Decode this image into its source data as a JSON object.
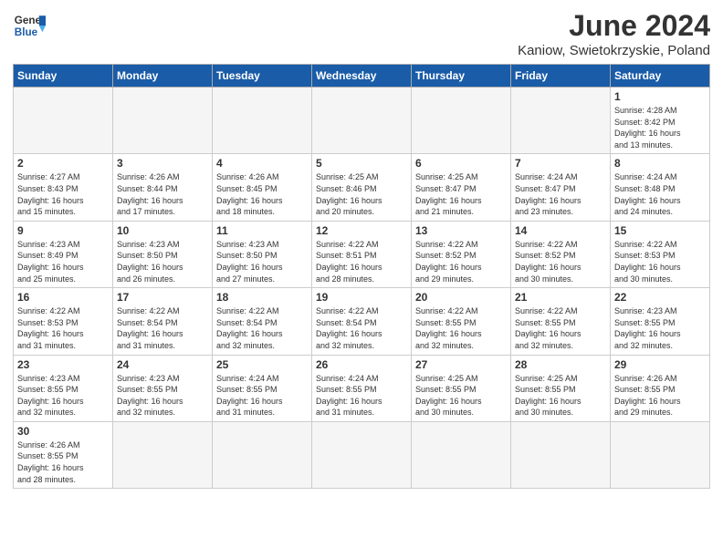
{
  "header": {
    "logo_general": "General",
    "logo_blue": "Blue",
    "title": "June 2024",
    "location": "Kaniow, Swietokrzyskie, Poland"
  },
  "days_of_week": [
    "Sunday",
    "Monday",
    "Tuesday",
    "Wednesday",
    "Thursday",
    "Friday",
    "Saturday"
  ],
  "weeks": [
    [
      {
        "day": "",
        "info": ""
      },
      {
        "day": "",
        "info": ""
      },
      {
        "day": "",
        "info": ""
      },
      {
        "day": "",
        "info": ""
      },
      {
        "day": "",
        "info": ""
      },
      {
        "day": "",
        "info": ""
      },
      {
        "day": "1",
        "info": "Sunrise: 4:28 AM\nSunset: 8:42 PM\nDaylight: 16 hours\nand 13 minutes."
      }
    ],
    [
      {
        "day": "2",
        "info": "Sunrise: 4:27 AM\nSunset: 8:43 PM\nDaylight: 16 hours\nand 15 minutes."
      },
      {
        "day": "3",
        "info": "Sunrise: 4:26 AM\nSunset: 8:44 PM\nDaylight: 16 hours\nand 17 minutes."
      },
      {
        "day": "4",
        "info": "Sunrise: 4:26 AM\nSunset: 8:45 PM\nDaylight: 16 hours\nand 18 minutes."
      },
      {
        "day": "5",
        "info": "Sunrise: 4:25 AM\nSunset: 8:46 PM\nDaylight: 16 hours\nand 20 minutes."
      },
      {
        "day": "6",
        "info": "Sunrise: 4:25 AM\nSunset: 8:47 PM\nDaylight: 16 hours\nand 21 minutes."
      },
      {
        "day": "7",
        "info": "Sunrise: 4:24 AM\nSunset: 8:47 PM\nDaylight: 16 hours\nand 23 minutes."
      },
      {
        "day": "8",
        "info": "Sunrise: 4:24 AM\nSunset: 8:48 PM\nDaylight: 16 hours\nand 24 minutes."
      }
    ],
    [
      {
        "day": "9",
        "info": "Sunrise: 4:23 AM\nSunset: 8:49 PM\nDaylight: 16 hours\nand 25 minutes."
      },
      {
        "day": "10",
        "info": "Sunrise: 4:23 AM\nSunset: 8:50 PM\nDaylight: 16 hours\nand 26 minutes."
      },
      {
        "day": "11",
        "info": "Sunrise: 4:23 AM\nSunset: 8:50 PM\nDaylight: 16 hours\nand 27 minutes."
      },
      {
        "day": "12",
        "info": "Sunrise: 4:22 AM\nSunset: 8:51 PM\nDaylight: 16 hours\nand 28 minutes."
      },
      {
        "day": "13",
        "info": "Sunrise: 4:22 AM\nSunset: 8:52 PM\nDaylight: 16 hours\nand 29 minutes."
      },
      {
        "day": "14",
        "info": "Sunrise: 4:22 AM\nSunset: 8:52 PM\nDaylight: 16 hours\nand 30 minutes."
      },
      {
        "day": "15",
        "info": "Sunrise: 4:22 AM\nSunset: 8:53 PM\nDaylight: 16 hours\nand 30 minutes."
      }
    ],
    [
      {
        "day": "16",
        "info": "Sunrise: 4:22 AM\nSunset: 8:53 PM\nDaylight: 16 hours\nand 31 minutes."
      },
      {
        "day": "17",
        "info": "Sunrise: 4:22 AM\nSunset: 8:54 PM\nDaylight: 16 hours\nand 31 minutes."
      },
      {
        "day": "18",
        "info": "Sunrise: 4:22 AM\nSunset: 8:54 PM\nDaylight: 16 hours\nand 32 minutes."
      },
      {
        "day": "19",
        "info": "Sunrise: 4:22 AM\nSunset: 8:54 PM\nDaylight: 16 hours\nand 32 minutes."
      },
      {
        "day": "20",
        "info": "Sunrise: 4:22 AM\nSunset: 8:55 PM\nDaylight: 16 hours\nand 32 minutes."
      },
      {
        "day": "21",
        "info": "Sunrise: 4:22 AM\nSunset: 8:55 PM\nDaylight: 16 hours\nand 32 minutes."
      },
      {
        "day": "22",
        "info": "Sunrise: 4:23 AM\nSunset: 8:55 PM\nDaylight: 16 hours\nand 32 minutes."
      }
    ],
    [
      {
        "day": "23",
        "info": "Sunrise: 4:23 AM\nSunset: 8:55 PM\nDaylight: 16 hours\nand 32 minutes."
      },
      {
        "day": "24",
        "info": "Sunrise: 4:23 AM\nSunset: 8:55 PM\nDaylight: 16 hours\nand 32 minutes."
      },
      {
        "day": "25",
        "info": "Sunrise: 4:24 AM\nSunset: 8:55 PM\nDaylight: 16 hours\nand 31 minutes."
      },
      {
        "day": "26",
        "info": "Sunrise: 4:24 AM\nSunset: 8:55 PM\nDaylight: 16 hours\nand 31 minutes."
      },
      {
        "day": "27",
        "info": "Sunrise: 4:25 AM\nSunset: 8:55 PM\nDaylight: 16 hours\nand 30 minutes."
      },
      {
        "day": "28",
        "info": "Sunrise: 4:25 AM\nSunset: 8:55 PM\nDaylight: 16 hours\nand 30 minutes."
      },
      {
        "day": "29",
        "info": "Sunrise: 4:26 AM\nSunset: 8:55 PM\nDaylight: 16 hours\nand 29 minutes."
      }
    ],
    [
      {
        "day": "30",
        "info": "Sunrise: 4:26 AM\nSunset: 8:55 PM\nDaylight: 16 hours\nand 28 minutes."
      },
      {
        "day": "",
        "info": ""
      },
      {
        "day": "",
        "info": ""
      },
      {
        "day": "",
        "info": ""
      },
      {
        "day": "",
        "info": ""
      },
      {
        "day": "",
        "info": ""
      },
      {
        "day": "",
        "info": ""
      }
    ]
  ]
}
